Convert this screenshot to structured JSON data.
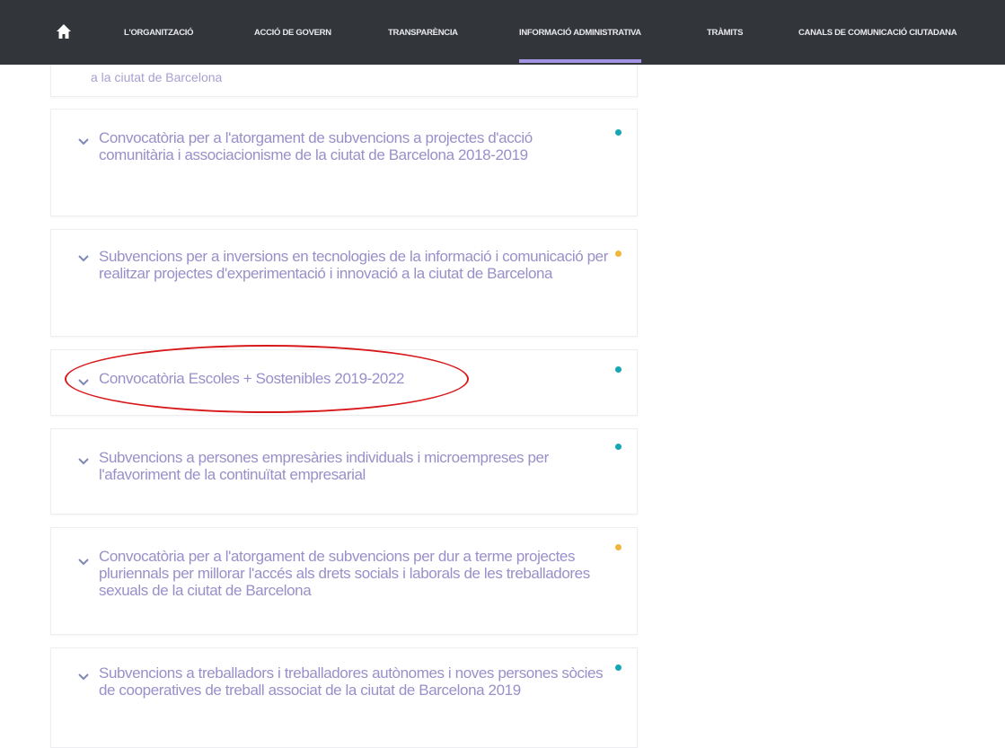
{
  "nav": {
    "items": [
      {
        "label": "L'ORGANITZACIÓ",
        "active": false
      },
      {
        "label": "ACCIÓ DE GOVERN",
        "active": false
      },
      {
        "label": "TRANSPARÈNCIA",
        "active": false
      },
      {
        "label": "INFORMACIÓ ADMINISTRATIVA",
        "active": true
      },
      {
        "label": "TRÀMITS",
        "active": false
      },
      {
        "label": "CANALS DE COMUNICACIÓ CIUTADANA",
        "active": false
      }
    ],
    "home_icon": "home-icon",
    "active_underline_color": "#a394e3"
  },
  "top_snippet": "a la ciutat de Barcelona",
  "cards": [
    {
      "title": "Convocatòria per a l'atorgament de subvencions a projectes d'acció comunitària i associacionisme de la ciutat de Barcelona 2018-2019",
      "status_color": "#14a7b6"
    },
    {
      "title": "Subvencions per a inversions en tecnologies de la informació i comunicació per realitzar projectes d'experimentació i innovació a la ciutat de Barcelona",
      "status_color": "#f0b53a"
    },
    {
      "title": "Convocatòria Escoles + Sostenibles 2019-2022",
      "status_color": "#14a7b6",
      "highlighted": true
    },
    {
      "title": "Subvencions a persones empresàries individuals i microempreses per l'afavoriment de la continuïtat empresarial",
      "status_color": "#14a7b6"
    },
    {
      "title": "Convocatòria per a l'atorgament de subvencions per dur a terme projectes pluriennals per millorar l'accés als drets socials i laborals de les treballadores sexuals de la ciutat de Barcelona",
      "status_color": "#f0b53a"
    },
    {
      "title": "Subvencions a treballadors i treballadores autònomes i noves persones sòcies de cooperatives de treball associat de la ciutat de Barcelona 2019",
      "status_color": "#14a7b6"
    }
  ],
  "highlight_color": "#d8191c"
}
